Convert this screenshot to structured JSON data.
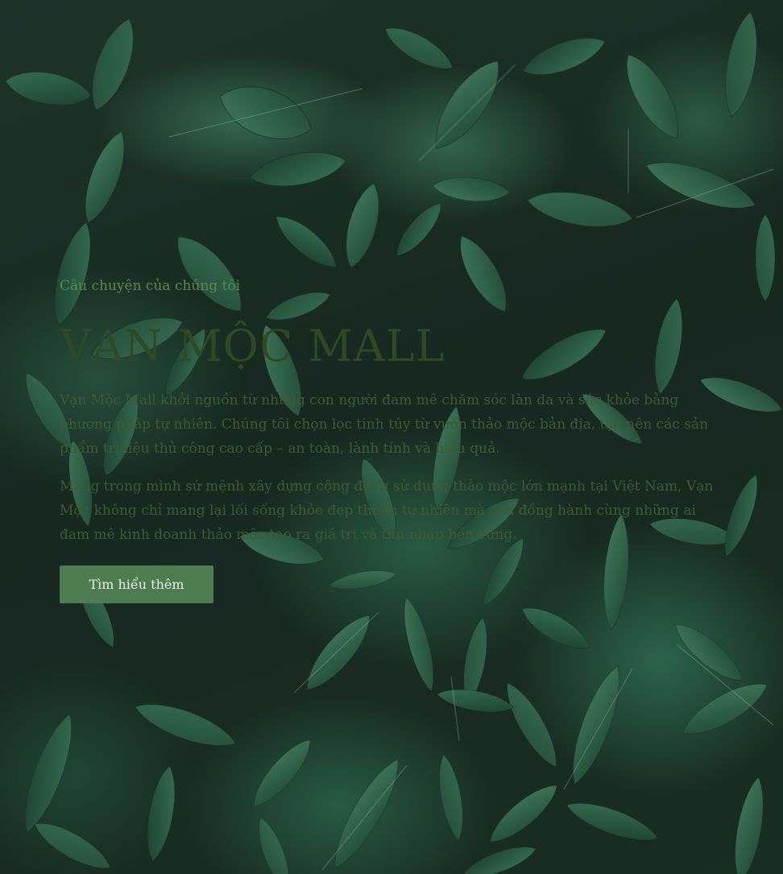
{
  "hero": {
    "subtitle": "Câu chuyện của chúng tôi",
    "title": "VẠN MỘC MALL",
    "paragraphs": [
      "Vạn Mộc Mall khởi nguồn từ những con người đam mê chăm sóc làn da và sức khỏe bằng phương pháp tự nhiên. Chúng tôi chọn lọc tinh túy từ vườn thảo mộc bản địa, tạo nên các sản phẩm trị liệu thủ công cao cấp – an toàn, lành tính và hiệu quả.",
      "Mang trong mình sứ mệnh xây dựng cộng đồng sử dụng thảo mộc lớn mạnh tại Việt Nam, Vạn Mộc không chỉ mang lại lối sống khỏe đẹp thuận tự nhiên mà còn đồng hành cùng những ai đam mê kinh doanh thảo mộc tạo ra giá trị và thu nhập bền vững."
    ],
    "cta_label": "Tìm hiểu thêm"
  },
  "colors": {
    "subtitle": "#5a8a4c",
    "title": "#2f4a22",
    "body_text": "#3f5a33",
    "button_bg": "#4d7c50",
    "button_text": "#e8f1e4"
  }
}
